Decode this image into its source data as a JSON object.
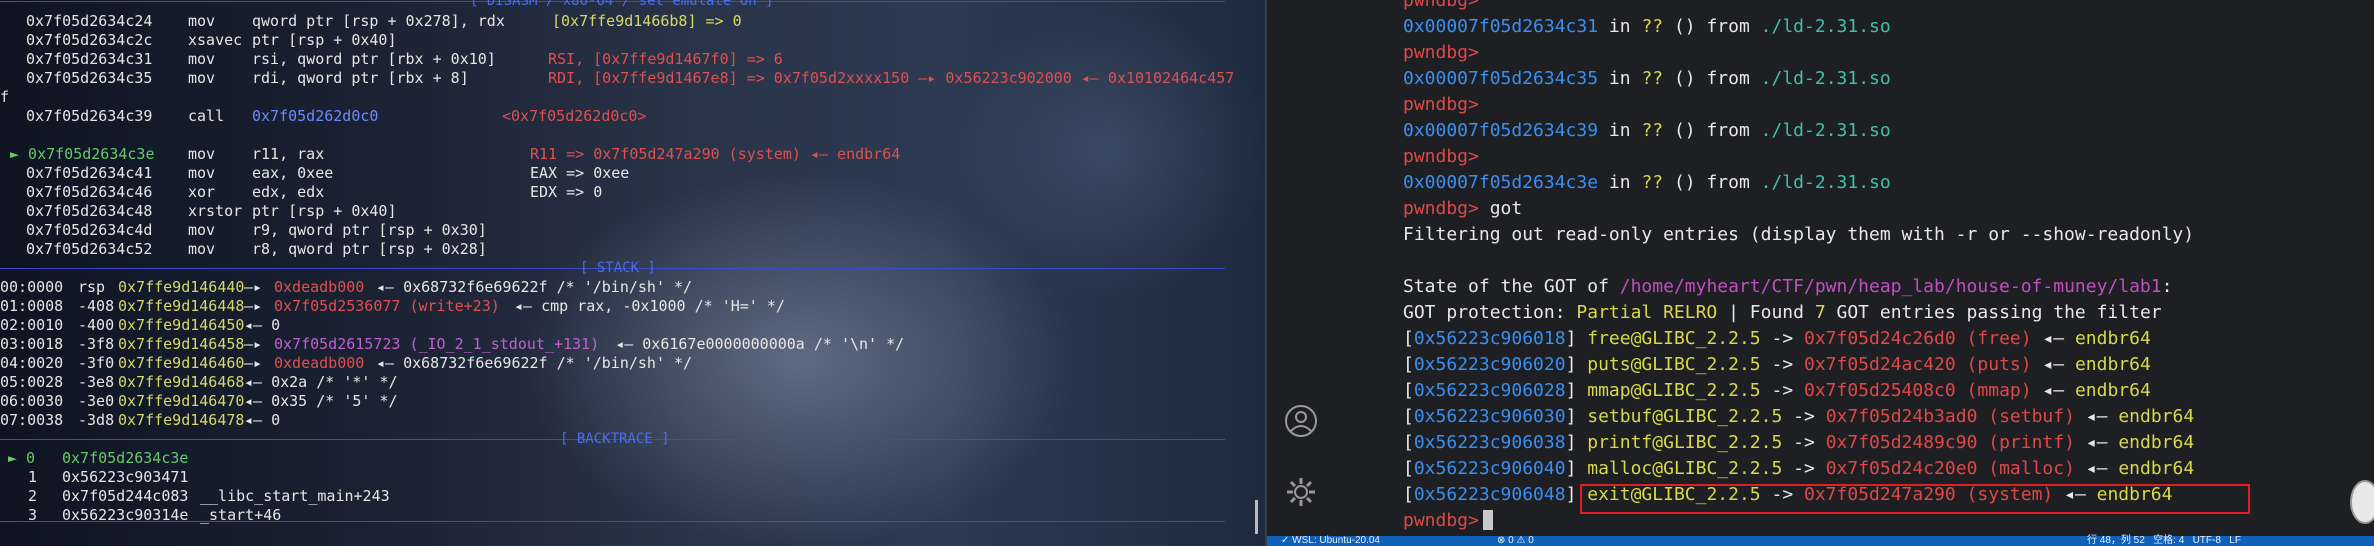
{
  "left": {
    "disasm_header": "[ DISASM / x86-64 / set emulate on ]",
    "disasm": [
      {
        "addr": "0x7f05d2634c24",
        "op": "mov",
        "args": "qword ptr [rsp + 0x278], rdx",
        "note": "[0x7ffe9d1466b8] => 0"
      },
      {
        "addr": "0x7f05d2634c2c",
        "op": "xsavec",
        "args": "ptr [rsp + 0x40]",
        "note": ""
      },
      {
        "addr": "0x7f05d2634c31",
        "op": "mov",
        "args": "rsi, qword ptr [rbx + 0x10]",
        "note": "RSI, [0x7ffe9d1467f0] => 6"
      },
      {
        "addr": "0x7f05d2634c35",
        "op": "mov",
        "args": "rdi, qword ptr [rbx + 8]",
        "note": "RDI, [0x7ffe9d1467e8] => 0x7f05d2xxxx150 —▸ 0x56223c902000 ◂— 0x10102464c457"
      },
      {
        "addr": "f",
        "op": "",
        "args": "",
        "note": ""
      },
      {
        "addr": "0x7f05d2634c39",
        "op": "call",
        "args": "0x7f05d262d0c0",
        "note": "<0x7f05d262d0c0>"
      },
      {
        "addr": "► 0x7f05d2634c3e",
        "op": "mov",
        "args": "r11, rax",
        "note": "R11 => 0x7f05d247a290 (system) ◂— endbr64"
      },
      {
        "addr": "0x7f05d2634c41",
        "op": "mov",
        "args": "eax, 0xee",
        "note": "EAX => 0xee"
      },
      {
        "addr": "0x7f05d2634c46",
        "op": "xor",
        "args": "edx, edx",
        "note": "EDX => 0"
      },
      {
        "addr": "0x7f05d2634c48",
        "op": "xrstor",
        "args": "ptr [rsp + 0x40]",
        "note": ""
      },
      {
        "addr": "0x7f05d2634c4d",
        "op": "mov",
        "args": "r9, qword ptr [rsp + 0x30]",
        "note": ""
      },
      {
        "addr": "0x7f05d2634c52",
        "op": "mov",
        "args": "r8, qword ptr [rsp + 0x28]",
        "note": ""
      }
    ],
    "stack_header": "[ STACK ]",
    "stack": [
      {
        "idx": "00:0000",
        "reg": "rsp",
        "addr": "0x7ffe9d146440",
        "arrow": "—▸",
        "target": "0xdeadb000",
        "rest": "◂— 0x68732f6e69622f /* '/bin/sh' */"
      },
      {
        "idx": "01:0008",
        "reg": "-408",
        "addr": "0x7ffe9d146448",
        "arrow": "—▸",
        "target": "0x7f05d2536077 (write+23)",
        "rest": "◂— cmp rax, -0x1000 /* 'H=' */"
      },
      {
        "idx": "02:0010",
        "reg": "-400",
        "addr": "0x7ffe9d146450",
        "arrow": "",
        "target": "",
        "rest": "◂— 0"
      },
      {
        "idx": "03:0018",
        "reg": "-3f8",
        "addr": "0x7ffe9d146458",
        "arrow": "—▸",
        "target": "0x7f05d2615723 (_IO_2_1_stdout_+131)",
        "rest": "◂— 0x6167e0000000000a /* '\\n' */"
      },
      {
        "idx": "04:0020",
        "reg": "-3f0",
        "addr": "0x7ffe9d146460",
        "arrow": "—▸",
        "target": "0xdeadb000",
        "rest": "◂— 0x68732f6e69622f /* '/bin/sh' */"
      },
      {
        "idx": "05:0028",
        "reg": "-3e8",
        "addr": "0x7ffe9d146468",
        "arrow": "",
        "target": "",
        "rest": "◂— 0x2a /* '*' */"
      },
      {
        "idx": "06:0030",
        "reg": "-3e0",
        "addr": "0x7ffe9d146470",
        "arrow": "",
        "target": "",
        "rest": "◂— 0x35 /* '5' */"
      },
      {
        "idx": "07:0038",
        "reg": "-3d8",
        "addr": "0x7ffe9d146478",
        "arrow": "",
        "target": "",
        "rest": "◂— 0"
      }
    ],
    "backtrace_header": "[ BACKTRACE ]",
    "backtrace": [
      {
        "n": "► 0",
        "addr": "0x7f05d2634c3e",
        "sym": ""
      },
      {
        "n": "1",
        "addr": "0x56223c903471",
        "sym": ""
      },
      {
        "n": "2",
        "addr": "0x7f05d244c083",
        "sym": "__libc_start_main+243"
      },
      {
        "n": "3",
        "addr": "0x56223c90314e",
        "sym": "_start+46"
      }
    ]
  },
  "terminal": {
    "prompt": "pwndbg>",
    "history": [
      {
        "addr": "0x00007f05d2634c31",
        "in": " in ",
        "fn": "??",
        "mid": " () from ",
        "lib": "./ld-2.31.so"
      },
      {
        "addr": "0x00007f05d2634c35",
        "in": " in ",
        "fn": "??",
        "mid": " () from ",
        "lib": "./ld-2.31.so"
      },
      {
        "addr": "0x00007f05d2634c39",
        "in": " in ",
        "fn": "??",
        "mid": " () from ",
        "lib": "./ld-2.31.so"
      },
      {
        "addr": "0x00007f05d2634c3e",
        "in": " in ",
        "fn": "??",
        "mid": " () from ",
        "lib": "./ld-2.31.so"
      }
    ],
    "command": "got",
    "filter_line": "Filtering out read-only entries (display them with -r or --show-readonly)",
    "state_prefix": "State of the GOT of ",
    "state_path": "/home/myheart/CTF/pwn/heap_lab/house-of-muney/lab1",
    "state_suffix": ":",
    "protection_prefix": "GOT protection: ",
    "protection_value": "Partial RELRO",
    "protection_mid": " | Found ",
    "protection_count": "7",
    "protection_suffix": " GOT entries passing the filter",
    "got_entries": [
      {
        "slot": "0x56223c906018",
        "sym": "free@GLIBC_2.2.5",
        "target": "0x7f05d24c26d0",
        "name": "(free)",
        "val": "endbr64"
      },
      {
        "slot": "0x56223c906020",
        "sym": "puts@GLIBC_2.2.5",
        "target": "0x7f05d24ac420",
        "name": "(puts)",
        "val": "endbr64"
      },
      {
        "slot": "0x56223c906028",
        "sym": "mmap@GLIBC_2.2.5",
        "target": "0x7f05d25408c0",
        "name": "(mmap)",
        "val": "endbr64"
      },
      {
        "slot": "0x56223c906030",
        "sym": "setbuf@GLIBC_2.2.5",
        "target": "0x7f05d24b3ad0",
        "name": "(setbuf)",
        "val": "endbr64"
      },
      {
        "slot": "0x56223c906038",
        "sym": "printf@GLIBC_2.2.5",
        "target": "0x7f05d2489c90",
        "name": "(printf)",
        "val": "endbr64"
      },
      {
        "slot": "0x56223c906040",
        "sym": "malloc@GLIBC_2.2.5",
        "target": "0x7f05d24c20e0",
        "name": "(malloc)",
        "val": "endbr64"
      },
      {
        "slot": "0x56223c906048",
        "sym": "exit@GLIBC_2.2.5",
        "target": "0x7f05d247a290",
        "name": "(system)",
        "val": "endbr64"
      }
    ]
  },
  "statusbar": {
    "left": "✓ WSL: Ubuntu-20.04",
    "mid": "⊗ 0 ⚠ 0",
    "right": "行 48，列 52   空格: 4   UTF-8   LF"
  },
  "colors": {
    "accent": "#0f62b8",
    "prompt": "#e04848",
    "addr": "#3fc0a8"
  }
}
